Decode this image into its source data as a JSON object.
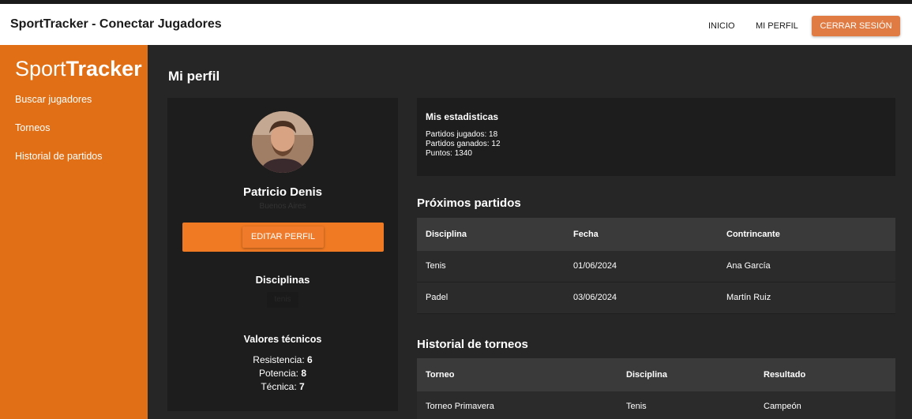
{
  "app": {
    "title": "SportTracker - Conectar Jugadores"
  },
  "nav": {
    "home": "INICIO",
    "profile": "MI PERFIL",
    "logout": "CERRAR SESIÓN"
  },
  "sidebar": {
    "brand_light": "Sport",
    "brand_bold": "Tracker",
    "items": [
      {
        "label": "Buscar jugadores"
      },
      {
        "label": "Torneos"
      },
      {
        "label": "Historial de partidos"
      }
    ]
  },
  "page": {
    "title": "Mi perfil"
  },
  "profile": {
    "name": "Patricio Denis",
    "city": "Buenos Aires",
    "edit_label": "EDITAR PERFIL",
    "disciplines_title": "Disciplinas",
    "discipline_chip": "tenis",
    "tech_title": "Valores técnicos",
    "tech": [
      {
        "label": "Resistencia: ",
        "value": "6"
      },
      {
        "label": "Potencia: ",
        "value": "8"
      },
      {
        "label": "Técnica: ",
        "value": "7"
      }
    ]
  },
  "stats": {
    "title": "Mis estadisticas",
    "lines": [
      "Partidos jugados: 18",
      "Partidos ganados: 12",
      "Puntos: 1340"
    ]
  },
  "upcoming": {
    "title": "Próximos partidos",
    "headers": [
      "Disciplina",
      "Fecha",
      "Contrincante"
    ],
    "rows": [
      [
        "Tenis",
        "01/06/2024",
        "Ana García"
      ],
      [
        "Padel",
        "03/06/2024",
        "Martín Ruiz"
      ]
    ]
  },
  "tournaments": {
    "title": "Historial de torneos",
    "headers": [
      "Torneo",
      "Disciplina",
      "Resultado"
    ],
    "rows": [
      [
        "Torneo Primavera",
        "Tenis",
        "Campeón"
      ]
    ]
  },
  "colors": {
    "accent": "#e06f16",
    "button": "#f07a24",
    "background": "#262626",
    "card": "#1d1d1d"
  }
}
